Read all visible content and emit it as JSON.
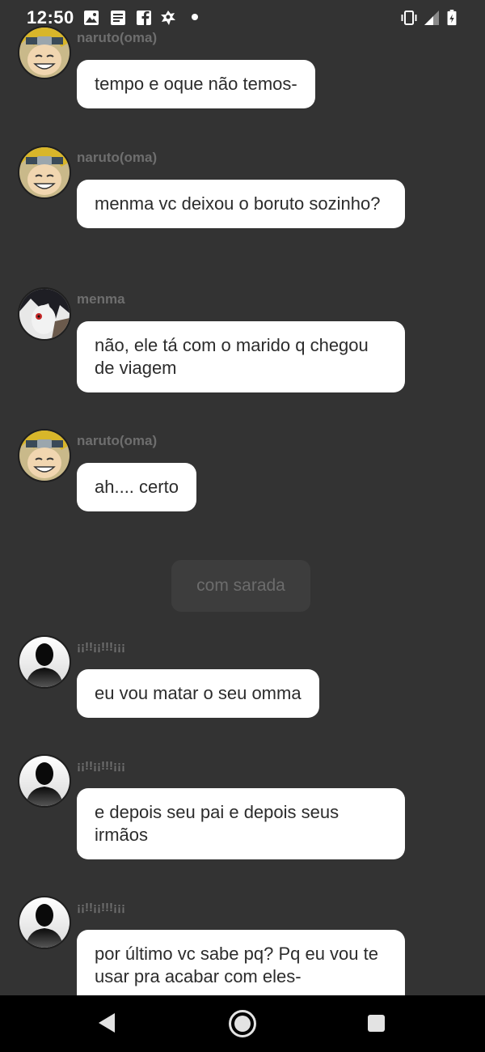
{
  "status_bar": {
    "time": "12:50",
    "left_icons": [
      "gallery-icon",
      "news-icon",
      "facebook-icon",
      "anime-icon"
    ],
    "right_icons": [
      "vibrate-icon",
      "signal-icon",
      "battery-icon"
    ]
  },
  "messages": [
    {
      "sender": "naruto(oma)",
      "avatar": "naruto-avatar",
      "text": "tempo e oque não temos-"
    },
    {
      "sender": "naruto(oma)",
      "avatar": "naruto-avatar",
      "text": "menma vc deixou o boruto sozinho?"
    },
    {
      "sender": "menma",
      "avatar": "menma-avatar",
      "text": "não, ele tá com o marido q chegou de viagem"
    },
    {
      "sender": "naruto(oma)",
      "avatar": "naruto-avatar",
      "text": "ah.... certo"
    },
    {
      "sender": "¡¡!!¡¡!!!¡¡¡",
      "avatar": "silhouette-avatar",
      "text": "eu vou matar o seu omma"
    },
    {
      "sender": "¡¡!!¡¡!!!¡¡¡",
      "avatar": "silhouette-avatar",
      "text": "e depois seu pai e depois seus irmãos"
    },
    {
      "sender": "¡¡!!¡¡!!!¡¡¡",
      "avatar": "silhouette-avatar",
      "text": "por último vc sabe pq? Pq eu vou te usar pra acabar com eles-"
    }
  ],
  "narrator": {
    "text": "com sarada"
  },
  "nav_bar": {
    "buttons": [
      "back-icon",
      "home-icon",
      "recents-icon"
    ]
  },
  "colors": {
    "background": "#333333",
    "bubble": "#ffffff",
    "sender_name": "#6e6e6e",
    "narrator_bg": "#3d3d3d"
  }
}
